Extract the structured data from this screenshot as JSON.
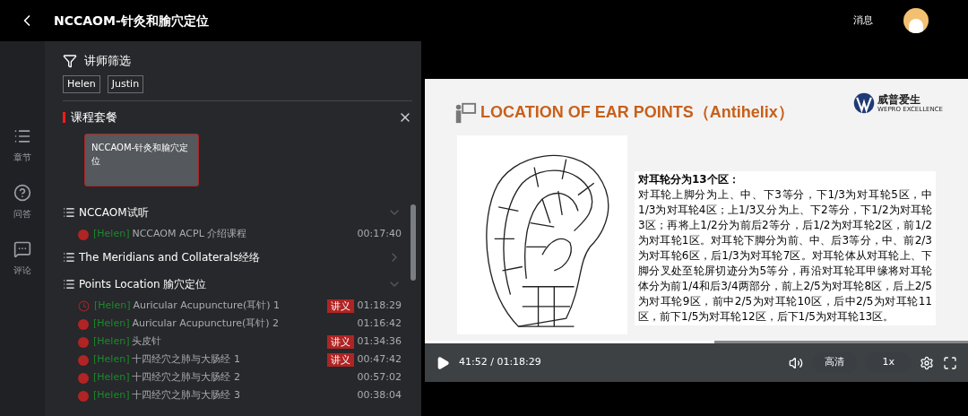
{
  "header": {
    "title": "NCCAOM-针灸和腧穴定位",
    "messages": "消息"
  },
  "rail": [
    {
      "label": "章节",
      "kind": "list"
    },
    {
      "label": "问答",
      "kind": "help"
    },
    {
      "label": "评论",
      "kind": "comment"
    }
  ],
  "filter": {
    "title": "讲师筛选",
    "teachers": [
      {
        "name": "Helen",
        "selected": false
      },
      {
        "name": "Justin",
        "selected": false
      }
    ]
  },
  "package": {
    "title": "课程套餐",
    "cards": [
      {
        "title": "NCCAOM-针灸和腧穴定位",
        "selected": true
      }
    ]
  },
  "chapters": [
    {
      "title": "NCCAOM试听",
      "expanded": true,
      "lessons": [
        {
          "kind": "dot",
          "teacher": "[Helen]",
          "title": "NCCAOM ACPL 介绍课程",
          "duration": "00:17:40"
        }
      ]
    },
    {
      "title": "The Meridians and Collaterals经络",
      "expanded": false
    },
    {
      "title": "Points Location 腧穴定位",
      "expanded": true,
      "lessons": [
        {
          "kind": "playing",
          "teacher": "[Helen]",
          "title": "Auricular Acupuncture(耳针) 1",
          "badge": "讲义",
          "duration": "01:18:29"
        },
        {
          "kind": "dot",
          "teacher": "[Helen]",
          "title": "Auricular Acupuncture(耳针) 2",
          "duration": "01:16:42"
        },
        {
          "kind": "dot",
          "teacher": "[Helen]",
          "title": "头皮针",
          "badge": "讲义",
          "duration": "01:34:36"
        },
        {
          "kind": "dot",
          "teacher": "[Helen]",
          "title": "十四经穴之肺与大肠经 1",
          "badge": "讲义",
          "duration": "00:47:42"
        },
        {
          "kind": "dot",
          "teacher": "[Helen]",
          "title": "十四经穴之肺与大肠经 2",
          "duration": "00:57:02"
        },
        {
          "kind": "dot",
          "teacher": "[Helen]",
          "title": "十四经穴之肺与大肠经 3",
          "duration": "00:38:04"
        }
      ]
    }
  ],
  "slide": {
    "title": "LOCATION OF EAR POINTS（Antihelix）",
    "logo_name": "威普爱生",
    "logo_tagline": "WEPRO EXCELLENCE",
    "heading": "对耳轮分为13个区：",
    "body": "对耳轮上脚分为上、中、下3等分，下1/3为对耳轮5区，中1/3为对耳轮4区；上1/3又分为上、下2等分，下1/2为对耳轮3区；再将上1/2分为前后2等分，后1/2为对耳轮2区，前1/2为对耳轮1区。对耳轮下脚分为前、中、后3等分，中、前2/3为对耳轮6区，后1/3为对耳轮7区。对耳轮体从对耳轮上、下脚分叉处至轮屏切迹分为5等分，再沿对耳轮耳甲缘将对耳轮体分为前1/4和后3/4两部分，前上2/5为对耳轮8区，后上2/5为对耳轮9区，前中2/5为对耳轮10区，后中2/5为对耳轮11区，前下1/5为对耳轮12区，后下1/5为对耳轮13区。"
  },
  "player": {
    "playing": false,
    "time": "41:52 / 01:18:29",
    "level": 0.533,
    "quality": "高清",
    "speed": "1x"
  }
}
